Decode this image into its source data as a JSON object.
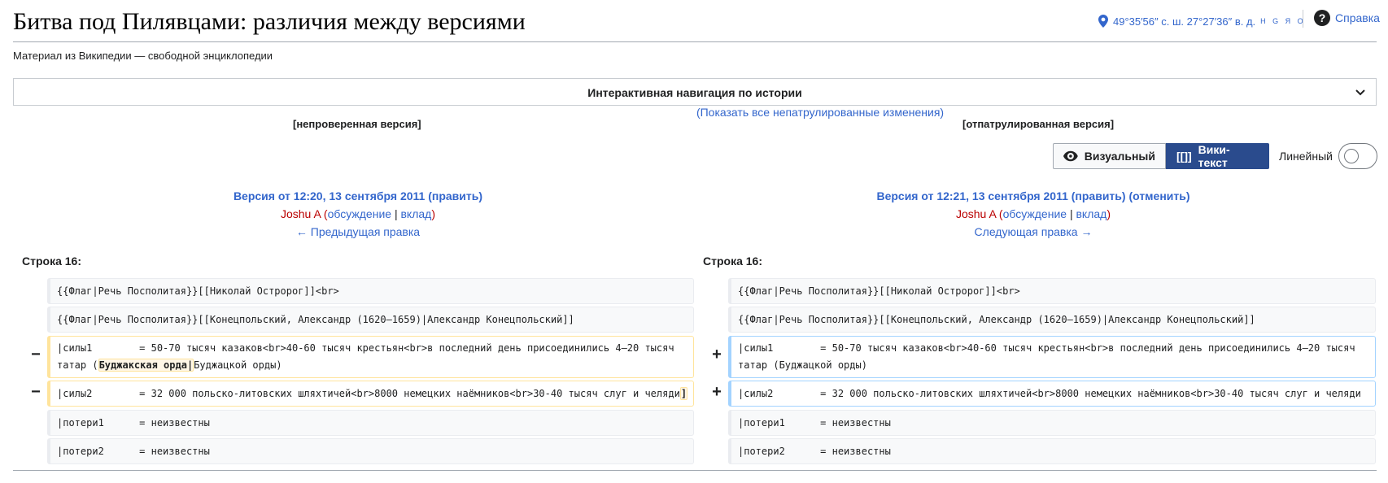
{
  "page": {
    "title": "Битва под Пилявцами: различия между версиями",
    "subtitle": "Материал из Википедии — свободной энциклопедии"
  },
  "header": {
    "coordinates": "49°35′56″ с. ш. 27°27′36″ в. д.",
    "coord_links": "H G Я O",
    "help_label": "Справка"
  },
  "nav": {
    "title": "Интерактивная навигация по истории",
    "show_unpatrolled": "(Показать все непатрулированные изменения)",
    "status_left": "[непроверенная версия]",
    "status_right": "[отпатрулированная версия]"
  },
  "toolbar": {
    "visual_label": "Визуальный",
    "wikitext_label": "Вики-текст",
    "wikitext_icon_text": "[[]]",
    "linear_label": "Линейный"
  },
  "revisions": {
    "left": {
      "version_prefix": "Версия от 12:20, 13 сентября 2011 (",
      "edit": "править",
      "close": ")",
      "user": "Joshu A",
      "talk_open": " (",
      "talk": "обсуждение",
      "sep": " | ",
      "contrib": "вклад",
      "talk_close": ")",
      "nav": "← Предыдущая правка"
    },
    "right": {
      "version_prefix": "Версия от 12:21, 13 сентября 2011 (",
      "edit": "править",
      "mid": ") (",
      "undo": "отменить",
      "close": ")",
      "user": "Joshu A",
      "talk_open": " (",
      "talk": "обсуждение",
      "sep": " | ",
      "contrib": "вклад",
      "talk_close": ")",
      "nav": "Следующая правка →"
    }
  },
  "diff": {
    "line_left": "Строка 16:",
    "line_right": "Строка 16:",
    "minus": "−",
    "plus": "+",
    "ctx1": "{{Флаг|Речь Посполитая}}[[Николай Остророг]]<br>",
    "ctx2": "{{Флаг|Речь Посполитая}}[[Конецпольский, Александр (1620—1659)|Александр Конецпольский]]",
    "del1_a": "|силы1        = 50-70 тысяч казаков<br>40-60 тысяч крестьян<br>в последний день присоединились 4—20 тысяч",
    "del1_b_pre": "татар (",
    "del1_b_hl": "Буджакская орда|",
    "del1_b_post": "Буджацкой орды)",
    "del2_pre": "|силы2        = 32 000 польско-литовских шляхтичей<br>8000 немецких наёмников<br>30-40 тысяч слуг и челяди",
    "del2_hl": "]",
    "add1_a": "|силы1        = 50-70 тысяч казаков<br>40-60 тысяч крестьян<br>в последний день присоединились 4—20 тысяч",
    "add1_b": "татар (Буджацкой орды)",
    "add2": "|силы2        = 32 000 польско-литовских шляхтичей<br>8000 немецких наёмников<br>30-40 тысяч слуг и челяди",
    "ctx3": "|потери1      = неизвестны",
    "ctx4": "|потери2      = неизвестны"
  }
}
